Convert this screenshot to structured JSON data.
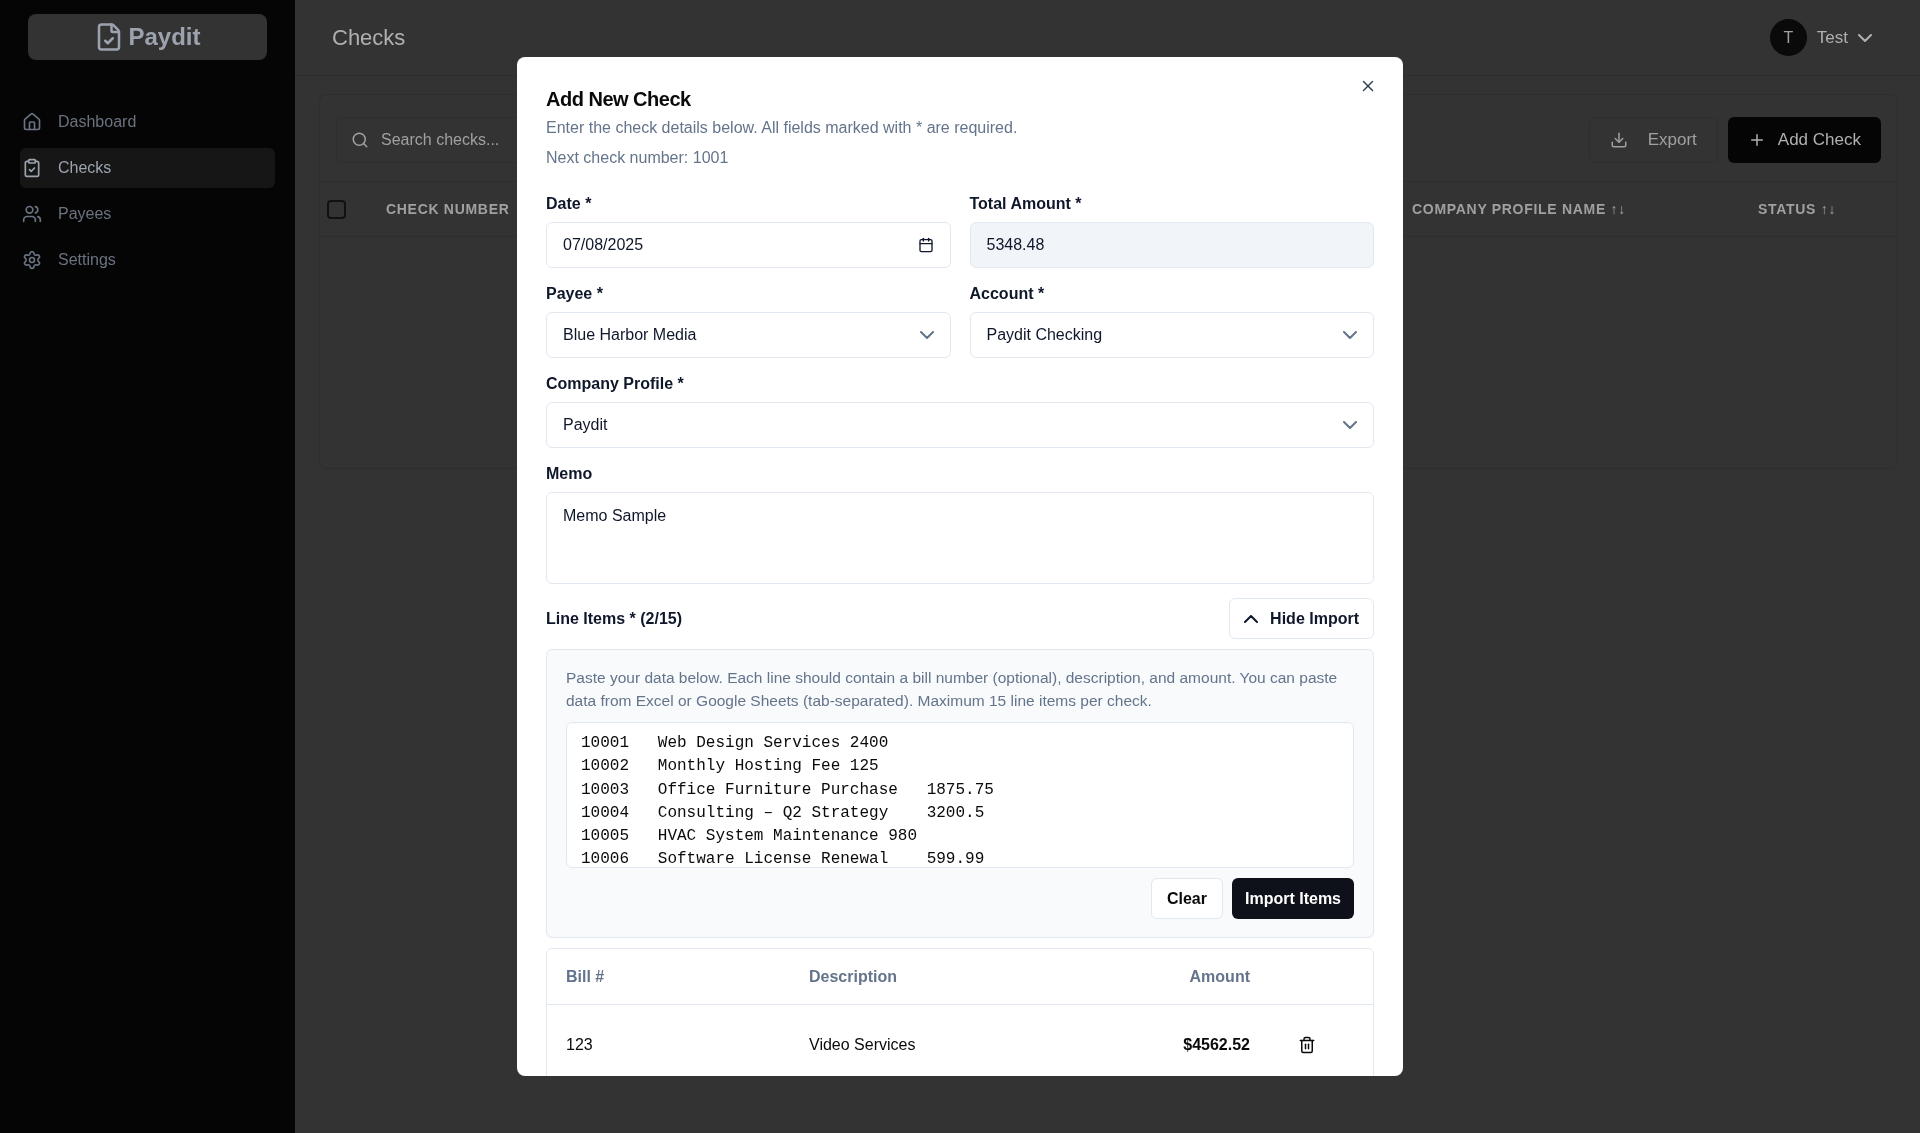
{
  "sidebar": {
    "logo": "Paydit",
    "items": [
      {
        "label": "Dashboard",
        "selected": false
      },
      {
        "label": "Checks",
        "selected": true
      },
      {
        "label": "Payees",
        "selected": false
      },
      {
        "label": "Settings",
        "selected": false
      }
    ]
  },
  "header": {
    "title": "Checks",
    "user": {
      "initial": "T",
      "name": "Test"
    }
  },
  "toolbar": {
    "search_placeholder": "Search checks...",
    "export": "Export",
    "add": "Add Check"
  },
  "table": {
    "select_all_checked": false,
    "columns": [
      {
        "label": "CHECK NUMBER"
      },
      {
        "label": "COMPANY PROFILE NAME ↑↓"
      },
      {
        "label": "STATUS ↑↓"
      }
    ]
  },
  "dialog": {
    "title": "Add New Check",
    "description": "Enter the check details below. All fields marked with * are required.",
    "next_number": "Next check number: 1001",
    "fields": [
      {
        "kind": "date",
        "label": "Date *",
        "value": "07/08/2025",
        "disabled": false
      },
      {
        "kind": "text",
        "label": "Total Amount *",
        "value": "5348.48",
        "disabled": true
      },
      {
        "kind": "select",
        "label": "Payee *",
        "value": "Blue Harbor Media",
        "disabled": false
      },
      {
        "kind": "select",
        "label": "Account *",
        "value": "Paydit Checking",
        "disabled": false
      },
      {
        "kind": "select",
        "label": "Company Profile *",
        "value": "Paydit",
        "disabled": false,
        "wide": true
      }
    ],
    "memo": {
      "label": "Memo",
      "value": "Memo Sample"
    },
    "line_items": {
      "label": "Line Items * (2/15)",
      "toggle": "Hide Import",
      "expanded": true,
      "import_help": "Paste your data below. Each line should contain a bill number (optional), description, and amount. You can paste data from Excel or Google Sheets (tab-separated). Maximum 15 line items per check.",
      "import_lines": [
        "10001\tWeb Design Services 2400",
        "10002\tMonthly Hosting Fee 125",
        "10003\tOffice Furniture Purchase\t1875.75",
        "10004\tConsulting – Q2 Strategy\t3200.5",
        "10005\tHVAC System Maintenance 980",
        "10006\tSoftware License Renewal\t599.99"
      ],
      "clear": "Clear",
      "import": "Import Items",
      "columns": [
        "Bill #",
        "Description",
        "Amount"
      ],
      "rows": [
        {
          "bill": "123",
          "description": "Video Services",
          "amount": "$4562.52"
        }
      ]
    }
  }
}
